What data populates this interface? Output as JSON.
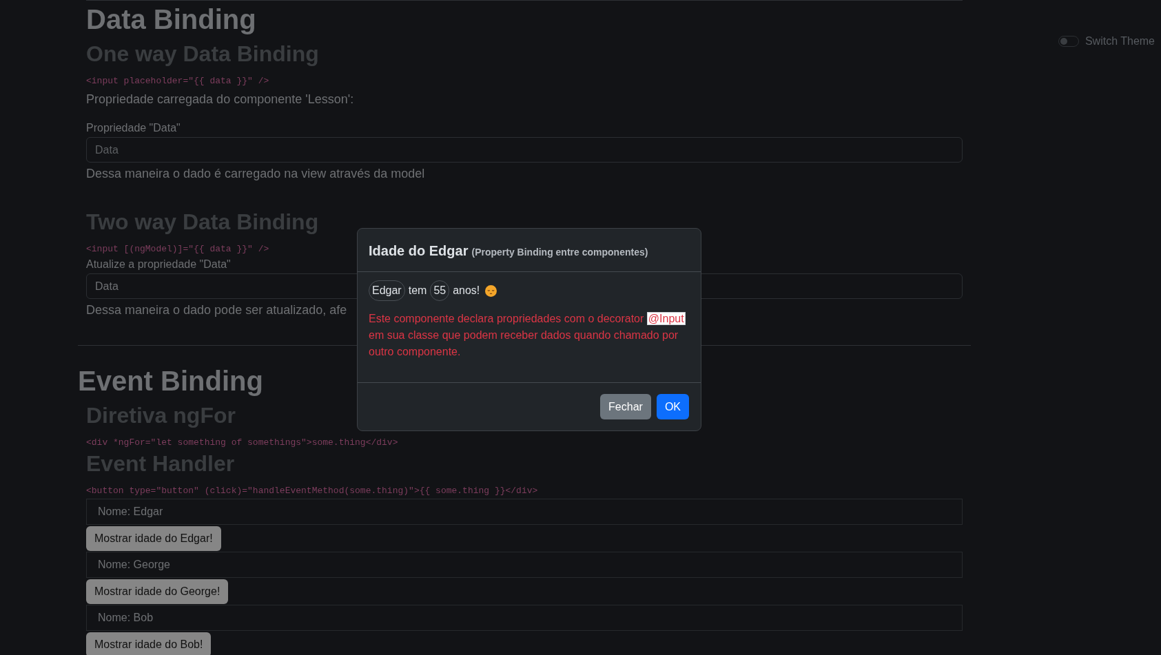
{
  "theme_switch": {
    "label": "Switch Theme",
    "on": false
  },
  "sections": [
    {
      "title": "Data Binding",
      "subsections": [
        {
          "title": "One way Data Binding",
          "code": "<input placeholder=\"{{ data }}\" />",
          "intro": "Propriedade carregada do componente 'Lesson':",
          "field": {
            "label": "Propriedade \"Data\"",
            "placeholder": "Data"
          },
          "note": "Dessa maneira o dado é carregado na view através da model"
        },
        {
          "title": "Two way Data Binding",
          "code": "<input [(ngModel)]=\"{{ data }}\" />",
          "field": {
            "label": "Atualize a propriedade \"Data\"",
            "value": "Data"
          },
          "note": "Dessa maneira o dado pode ser atualizado, afe"
        }
      ]
    },
    {
      "title": "Event Binding",
      "subsections": [
        {
          "title": "Diretiva ngFor",
          "code": "<div *ngFor=\"let something of somethings\">some.thing</div>"
        },
        {
          "title": "Event Handler",
          "code": "<button type=\"button\" (click)=\"handleEventMethod(some.thing)\">{{ some.thing }}</div>",
          "people": [
            {
              "name": "Nome: Edgar",
              "button": "Mostrar idade do Edgar!"
            },
            {
              "name": "Nome: George",
              "button": "Mostrar idade do George!"
            },
            {
              "name": "Nome: Bob",
              "button": "Mostrar idade do Bob!"
            }
          ]
        }
      ]
    }
  ],
  "modal": {
    "title": "Idade do Edgar",
    "subtitle": "(Property Binding entre componentes)",
    "summary": [
      {
        "kind": "badge",
        "text": "Edgar"
      },
      {
        "kind": "text",
        "text": "tem"
      },
      {
        "kind": "badge",
        "text": "55"
      },
      {
        "kind": "text",
        "text": "anos!"
      }
    ],
    "description": [
      {
        "text": "Este componente declara propriedades com o decorator ",
        "highlighted": false
      },
      {
        "text": "@Input",
        "highlighted": true
      },
      {
        "text": " em sua classe que podem receber dados quando chamado por outro componente.",
        "highlighted": false
      }
    ],
    "buttons": [
      {
        "label": "Fechar",
        "kind": "secondary"
      },
      {
        "label": "OK",
        "kind": "primary"
      }
    ]
  }
}
